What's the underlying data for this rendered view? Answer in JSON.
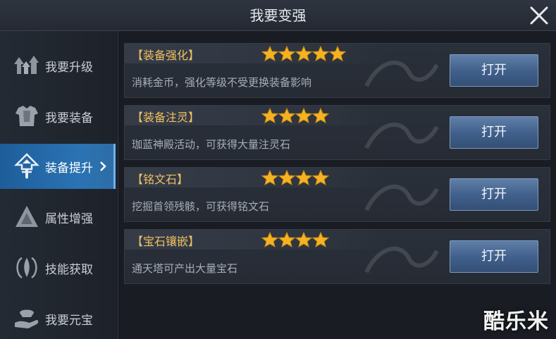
{
  "header": {
    "title": "我要变强"
  },
  "sidebar": {
    "items": [
      {
        "label": "我要升级",
        "icon": "level-up-arrows-icon"
      },
      {
        "label": "我要装备",
        "icon": "armor-icon"
      },
      {
        "label": "装备提升",
        "icon": "sword-upgrade-icon",
        "active": true
      },
      {
        "label": "属性增强",
        "icon": "triangle-rune-icon"
      },
      {
        "label": "技能获取",
        "icon": "skill-flame-icon"
      },
      {
        "label": "我要元宝",
        "icon": "hand-ingot-icon"
      }
    ]
  },
  "cards": [
    {
      "title": "【装备强化】",
      "stars": 5,
      "desc": "消耗金币，强化等级不受更换装备影响",
      "button": "打开"
    },
    {
      "title": "【装备注灵】",
      "stars": 4,
      "desc": "珈蓝神殿活动，可获得大量注灵石",
      "button": "打开"
    },
    {
      "title": "【铭文石】",
      "stars": 4,
      "desc": "挖掘首领残骸，可获得铭文石",
      "button": "打开"
    },
    {
      "title": "【宝石镶嵌】",
      "stars": 4,
      "desc": "通天塔可产出大量宝石",
      "button": "打开"
    }
  ],
  "watermark": "酷乐米",
  "colors": {
    "accent": "#2b73b4",
    "title_gold": "#f0c060",
    "star": "#f5b323",
    "button": "#4a6a96"
  }
}
